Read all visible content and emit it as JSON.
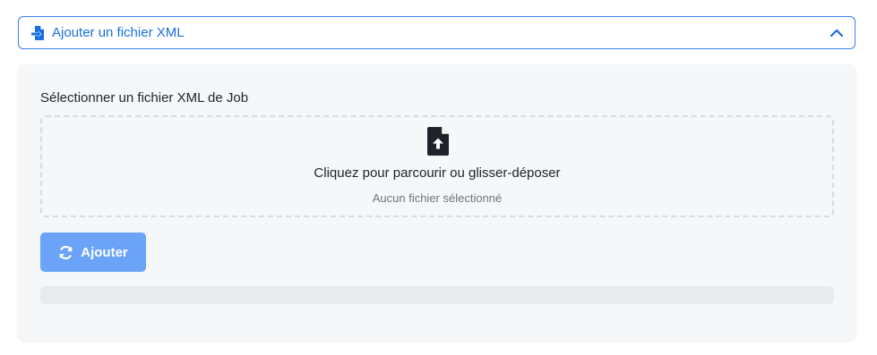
{
  "accordion": {
    "title": "Ajouter un fichier XML",
    "icon": "file-import-icon",
    "expanded": true,
    "accent_color": "#1a6fe0"
  },
  "upload": {
    "label": "Sélectionner un fichier XML de Job",
    "dropzone_text": "Cliquez pour parcourir ou glisser-déposer",
    "file_status": "Aucun fichier sélectionné",
    "icon": "file-upload-icon"
  },
  "actions": {
    "add_label": "Ajouter",
    "add_icon": "sync-icon",
    "button_color": "#6aa3f7"
  },
  "progress": {
    "value": 0
  }
}
